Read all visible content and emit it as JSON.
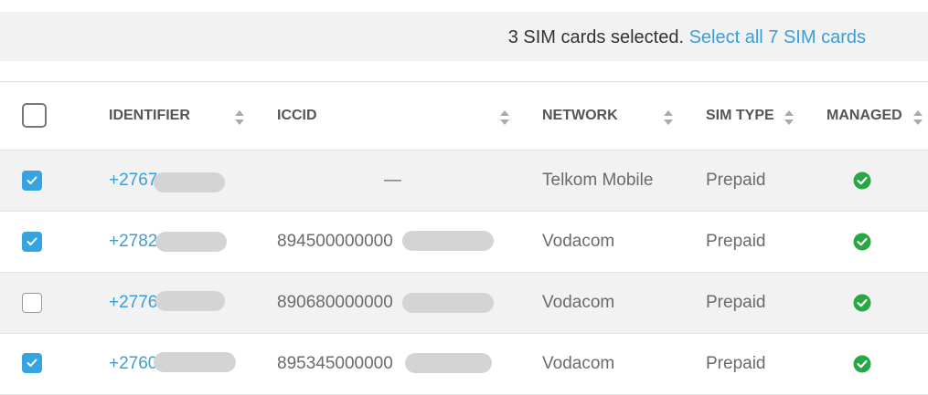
{
  "banner": {
    "selected_text": "3 SIM cards selected.",
    "select_all_link": "Select all 7 SIM cards"
  },
  "table": {
    "columns": {
      "identifier": "IDENTIFIER",
      "iccid": "ICCID",
      "network": "NETWORK",
      "sim_type": "SIM TYPE",
      "managed": "MANAGED"
    },
    "header_checked": false,
    "rows": [
      {
        "checked": true,
        "identifier": "+2767",
        "iccid": "—",
        "network": "Telkom Mobile",
        "sim_type": "Prepaid",
        "managed": true
      },
      {
        "checked": true,
        "identifier": "+2782",
        "iccid": "894500000000",
        "network": "Vodacom",
        "sim_type": "Prepaid",
        "managed": true
      },
      {
        "checked": false,
        "identifier": "+2776",
        "iccid": "890680000000",
        "network": "Vodacom",
        "sim_type": "Prepaid",
        "managed": true
      },
      {
        "checked": true,
        "identifier": "+2760",
        "iccid": "895345000000",
        "network": "Vodacom",
        "sim_type": "Prepaid",
        "managed": true
      }
    ]
  },
  "colors": {
    "accent": "#3a9fd6",
    "checkbox_checked": "#35a4e0",
    "managed_ok": "#28a745",
    "row_shade": "#f2f2f2",
    "redaction": "#d4d4d4"
  },
  "icons": {
    "sort": "sort-icon",
    "managed": "check-circle-icon",
    "checkbox_check": "checkmark-icon"
  }
}
